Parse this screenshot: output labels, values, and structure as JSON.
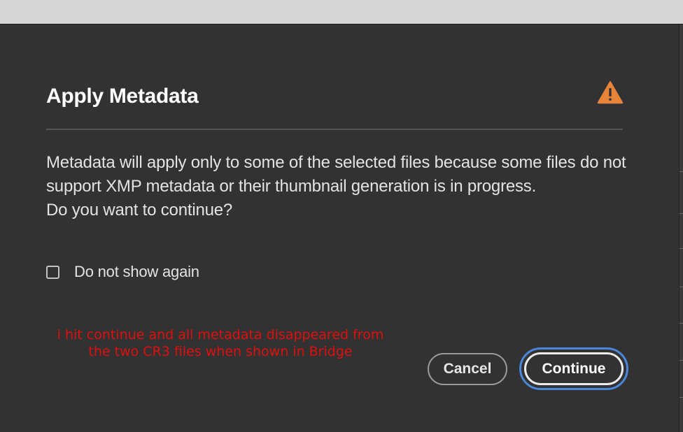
{
  "dialog": {
    "title": "Apply Metadata",
    "message_lines": [
      "Metadata will apply only to some of the selected files because some files do not support XMP metadata or their thumbnail generation is in progress.",
      "Do you want to continue?"
    ],
    "checkbox": {
      "label": "Do not show again",
      "checked": false
    },
    "annotation_lines": [
      "i hit continue and all metadata disappeared from",
      "the two CR3 files when shown in Bridge"
    ],
    "buttons": {
      "cancel": "Cancel",
      "continue": "Continue"
    },
    "icon": "warning-icon"
  },
  "colors": {
    "background": "#323232",
    "warning": "#e8843a",
    "focus_ring": "#4a86d9",
    "annotation": "#e00e0e"
  }
}
